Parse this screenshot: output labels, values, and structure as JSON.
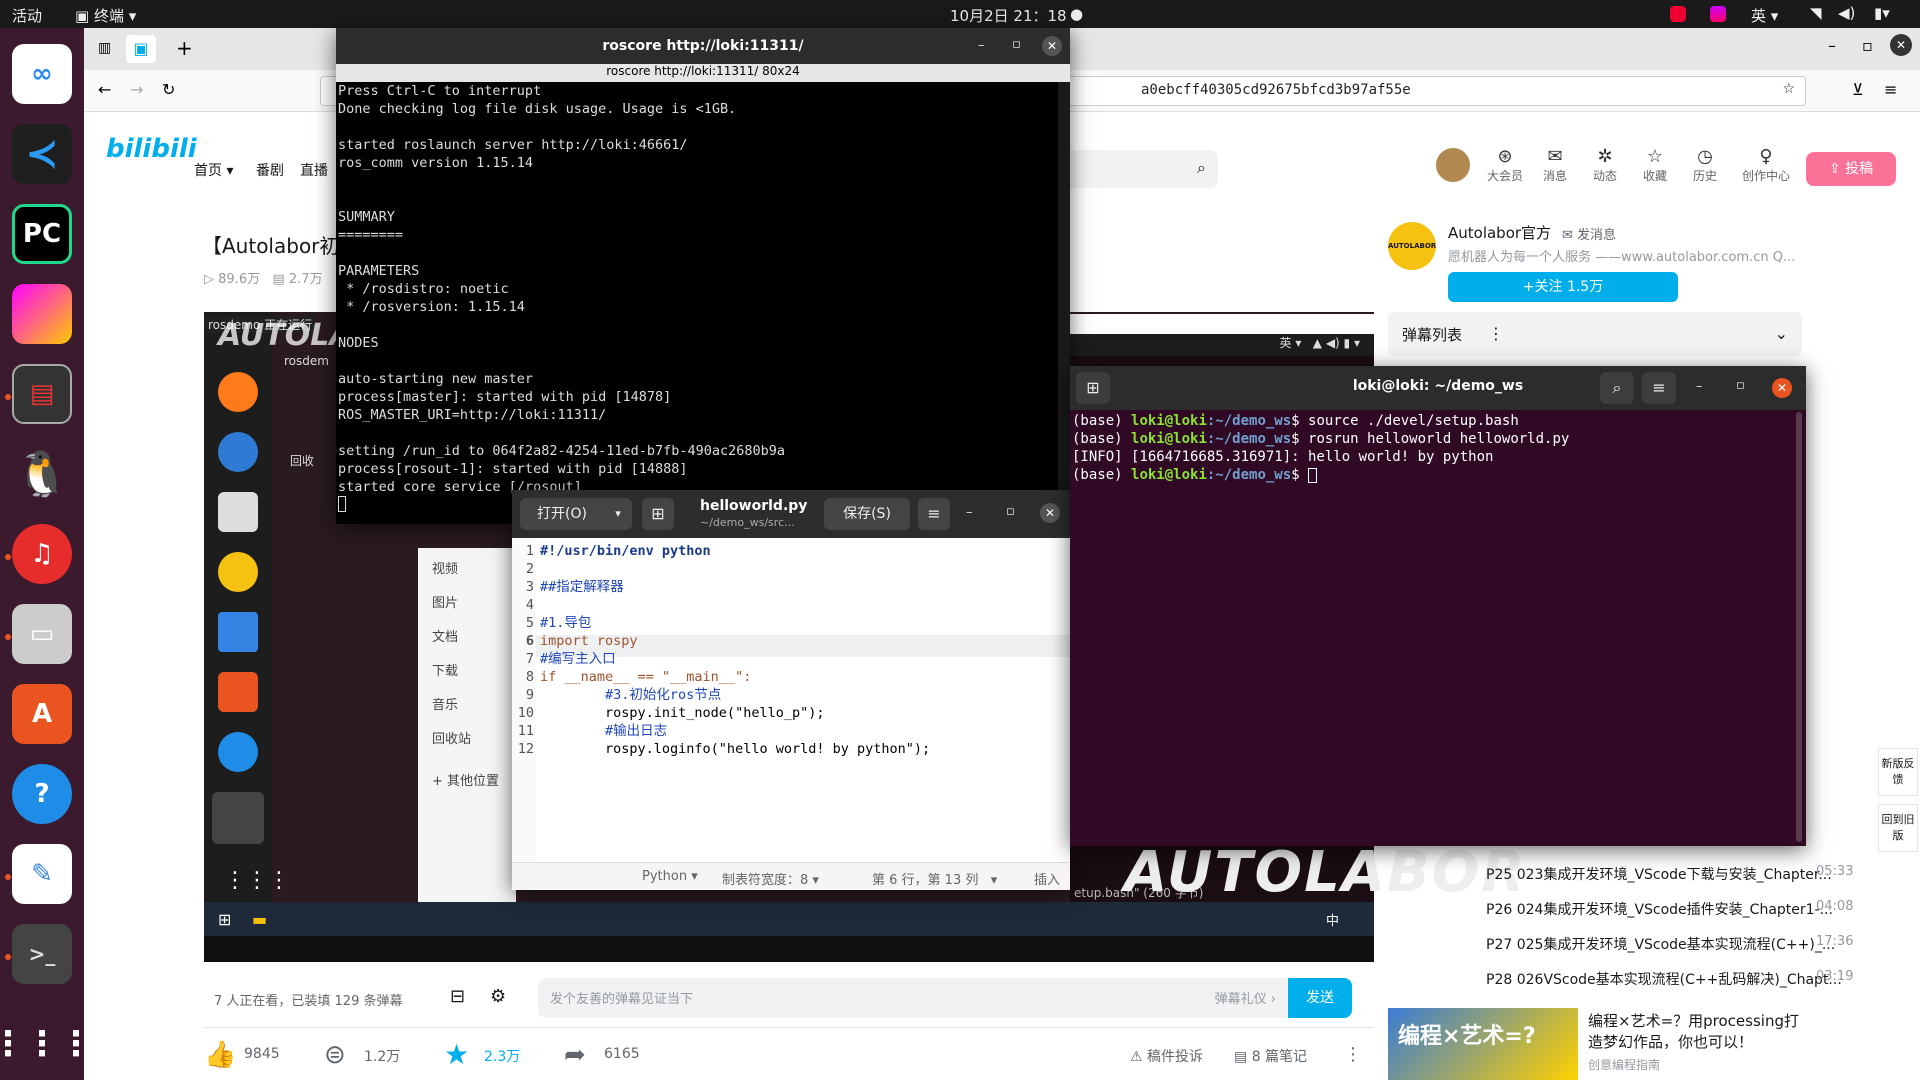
{
  "topbar": {
    "activities": "活动",
    "terminal": "终端",
    "clock": "10月2日  21：18",
    "ime": "英"
  },
  "browser": {
    "url": "a0ebcff40305cd92675bfcd3b97af55e"
  },
  "bili": {
    "logo": "bilibili",
    "nav": [
      "首页",
      "番剧",
      "直播"
    ],
    "header_icons": [
      {
        "label": "大会员",
        "icon": "vip-icon"
      },
      {
        "label": "消息",
        "icon": "message-icon"
      },
      {
        "label": "动态",
        "icon": "dynamic-icon"
      },
      {
        "label": "收藏",
        "icon": "star-icon"
      },
      {
        "label": "历史",
        "icon": "history-icon"
      },
      {
        "label": "创作中心",
        "icon": "bulb-icon"
      }
    ],
    "upload": "投稿",
    "video_title": "【Autolabor初级",
    "views": "89.6万",
    "danmaku_count": "2.7万",
    "up": {
      "name": "Autolabor官方",
      "msg": "发消息",
      "desc": "愿机器人为每一个人服务 ——www.autolabor.com.cn Q...",
      "follow": "+关注 1.5万",
      "avatar": "AUTOLABOR"
    },
    "danmaku_list": "弹幕列表",
    "watching": "7 人正在看，已装填 129 条弹幕",
    "danmaku_placeholder": "发个友善的弹幕见证当下",
    "danmaku_etiquette": "弹幕礼仪 ›",
    "send": "发送",
    "actions": {
      "like": "9845",
      "coin": "1.2万",
      "fav": "2.3万",
      "share": "6165"
    },
    "report": "稿件投诉",
    "notes": "8 篇笔记",
    "playlist": [
      {
        "p": "P25",
        "title": "023集成开发环境_VScode下载与安装_Chapter...",
        "time": "05:33"
      },
      {
        "p": "P26",
        "title": "024集成开发环境_VScode插件安装_Chapter1-...",
        "time": "04:08"
      },
      {
        "p": "P27",
        "title": "025集成开发环境_VScode基本实现流程(C++)_...",
        "time": "17:36"
      },
      {
        "p": "P28",
        "title": "026VScode基本实现流程(C++乱码解决)_Chapt...",
        "time": "03:19"
      }
    ],
    "ad": {
      "title": "编程×艺术=？用processing打造梦幻作品，你也可以！",
      "sub": "创意编程指南",
      "img_text": "编程×艺术=?"
    },
    "side_float": [
      "新版反馈",
      "回到旧版"
    ]
  },
  "roscore": {
    "title": "roscore http://loki:11311/",
    "subtitle": "roscore http://loki:11311/ 80x24",
    "lines": [
      "Press Ctrl-C to interrupt",
      "Done checking log file disk usage. Usage is <1GB.",
      "",
      "started roslaunch server http://loki:46661/",
      "ros_comm version 1.15.14",
      "",
      "",
      "SUMMARY",
      "========",
      "",
      "PARAMETERS",
      " * /rosdistro: noetic",
      " * /rosversion: 1.15.14",
      "",
      "NODES",
      "",
      "auto-starting new master",
      "process[master]: started with pid [14878]",
      "ROS_MASTER_URI=http://loki:11311/",
      "",
      "setting /run_id to 064f2a82-4254-11ed-b7fb-490ac2680b9a",
      "process[rosout-1]: started with pid [14888]",
      "started core service [/rosout]"
    ]
  },
  "gedit": {
    "open": "打开(O)",
    "filename": "helloworld.py",
    "path": "~/demo_ws/src...",
    "save": "保存(S)",
    "code": [
      "#!/usr/bin/env python",
      "",
      "##指定解释器",
      "",
      "#1.导包",
      "import rospy",
      "#编写主入口",
      "if __name__ == \"__main__\":",
      "        #3.初始化ros节点",
      "        rospy.init_node(\"hello_p\");",
      "        #输出日志",
      "        rospy.loginfo(\"hello world! by python\");"
    ],
    "status": {
      "lang": "Python",
      "tab": "制表符宽度：8",
      "pos": "第 6 行，第 13 列",
      "mode": "插入"
    }
  },
  "terminal2": {
    "title": "loki@loki: ~/demo_ws",
    "lines": [
      {
        "pre": "(base) ",
        "user": "loki@loki",
        "path": ":~/demo_ws",
        "cmd": "$ source ./devel/setup.bash"
      },
      {
        "pre": "(base) ",
        "user": "loki@loki",
        "path": ":~/demo_ws",
        "cmd": "$ rosrun helloworld helloworld.py"
      },
      {
        "pre": "[INFO] [1664716685.316971]: hello world! by python",
        "user": "",
        "path": "",
        "cmd": ""
      },
      {
        "pre": "(base) ",
        "user": "loki@loki",
        "path": ":~/demo_ws",
        "cmd": "$ "
      }
    ]
  },
  "video": {
    "files_sidebar": [
      "视频",
      "图片",
      "文档",
      "下载",
      "音乐",
      "回收站",
      "+ 其他位置"
    ],
    "desktop_labels": [
      "rosdem",
      "回收"
    ],
    "overlay_text": "rosdemo 正在运行",
    "inner_status": "etup.bash\" (260 字节)",
    "watermark": "AUTOLABOR"
  },
  "colors": {
    "bili_pink": "#fb7299",
    "bili_blue": "#00aeec",
    "term_purple": "#300a24",
    "ubuntu_orange": "#e95420"
  }
}
